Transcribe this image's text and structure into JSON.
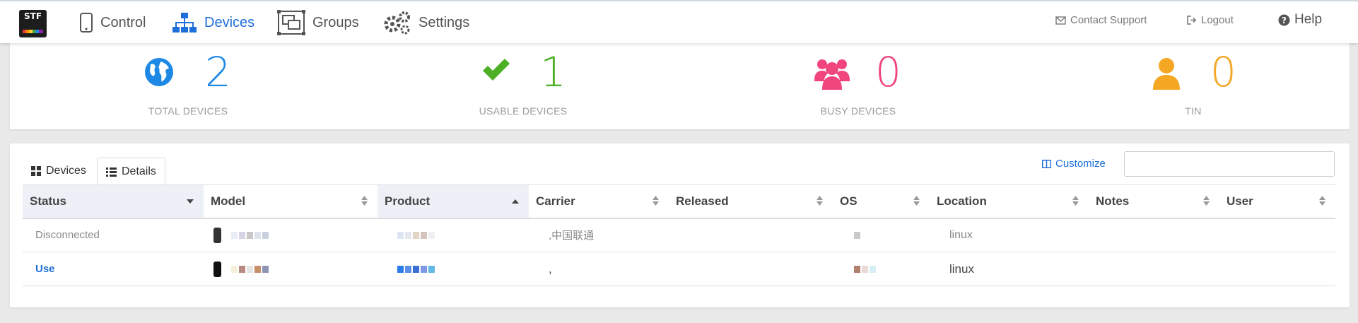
{
  "nav": {
    "logo_text": "STF",
    "items": [
      {
        "label": "Control",
        "icon": "phone-icon"
      },
      {
        "label": "Devices",
        "icon": "sitemap-icon",
        "active": true
      },
      {
        "label": "Groups",
        "icon": "groups-icon"
      },
      {
        "label": "Settings",
        "icon": "gears-icon"
      }
    ],
    "contact_support": "Contact Support",
    "logout": "Logout",
    "help": "Help"
  },
  "stats": [
    {
      "value": "2",
      "label": "TOTAL DEVICES",
      "color": "#1e88e5",
      "icon": "globe-icon"
    },
    {
      "value": "1",
      "label": "USABLE DEVICES",
      "color": "#4caf24",
      "icon": "check-icon"
    },
    {
      "value": "0",
      "label": "BUSY DEVICES",
      "color": "#f0457d",
      "icon": "users-icon"
    },
    {
      "value": "0",
      "label": "TIN",
      "color": "#f5a623",
      "icon": "user-icon"
    }
  ],
  "tabs": [
    {
      "label": "Devices",
      "icon": "grid-icon"
    },
    {
      "label": "Details",
      "icon": "list-icon",
      "active": true
    }
  ],
  "customize_label": "Customize",
  "search": {
    "value": "",
    "placeholder": ""
  },
  "columns": [
    "Status",
    "Model",
    "Product",
    "Carrier",
    "Released",
    "OS",
    "Location",
    "Notes",
    "User"
  ],
  "rows": [
    {
      "status": "Disconnected",
      "model": "",
      "product": "",
      "carrier": ",中国联通",
      "released": "",
      "os": "",
      "location": "linux",
      "notes": "",
      "user": ""
    },
    {
      "status": "Use",
      "model": "",
      "product": "",
      "carrier": ",",
      "released": "",
      "os": "",
      "location": "linux",
      "notes": "",
      "user": ""
    }
  ]
}
